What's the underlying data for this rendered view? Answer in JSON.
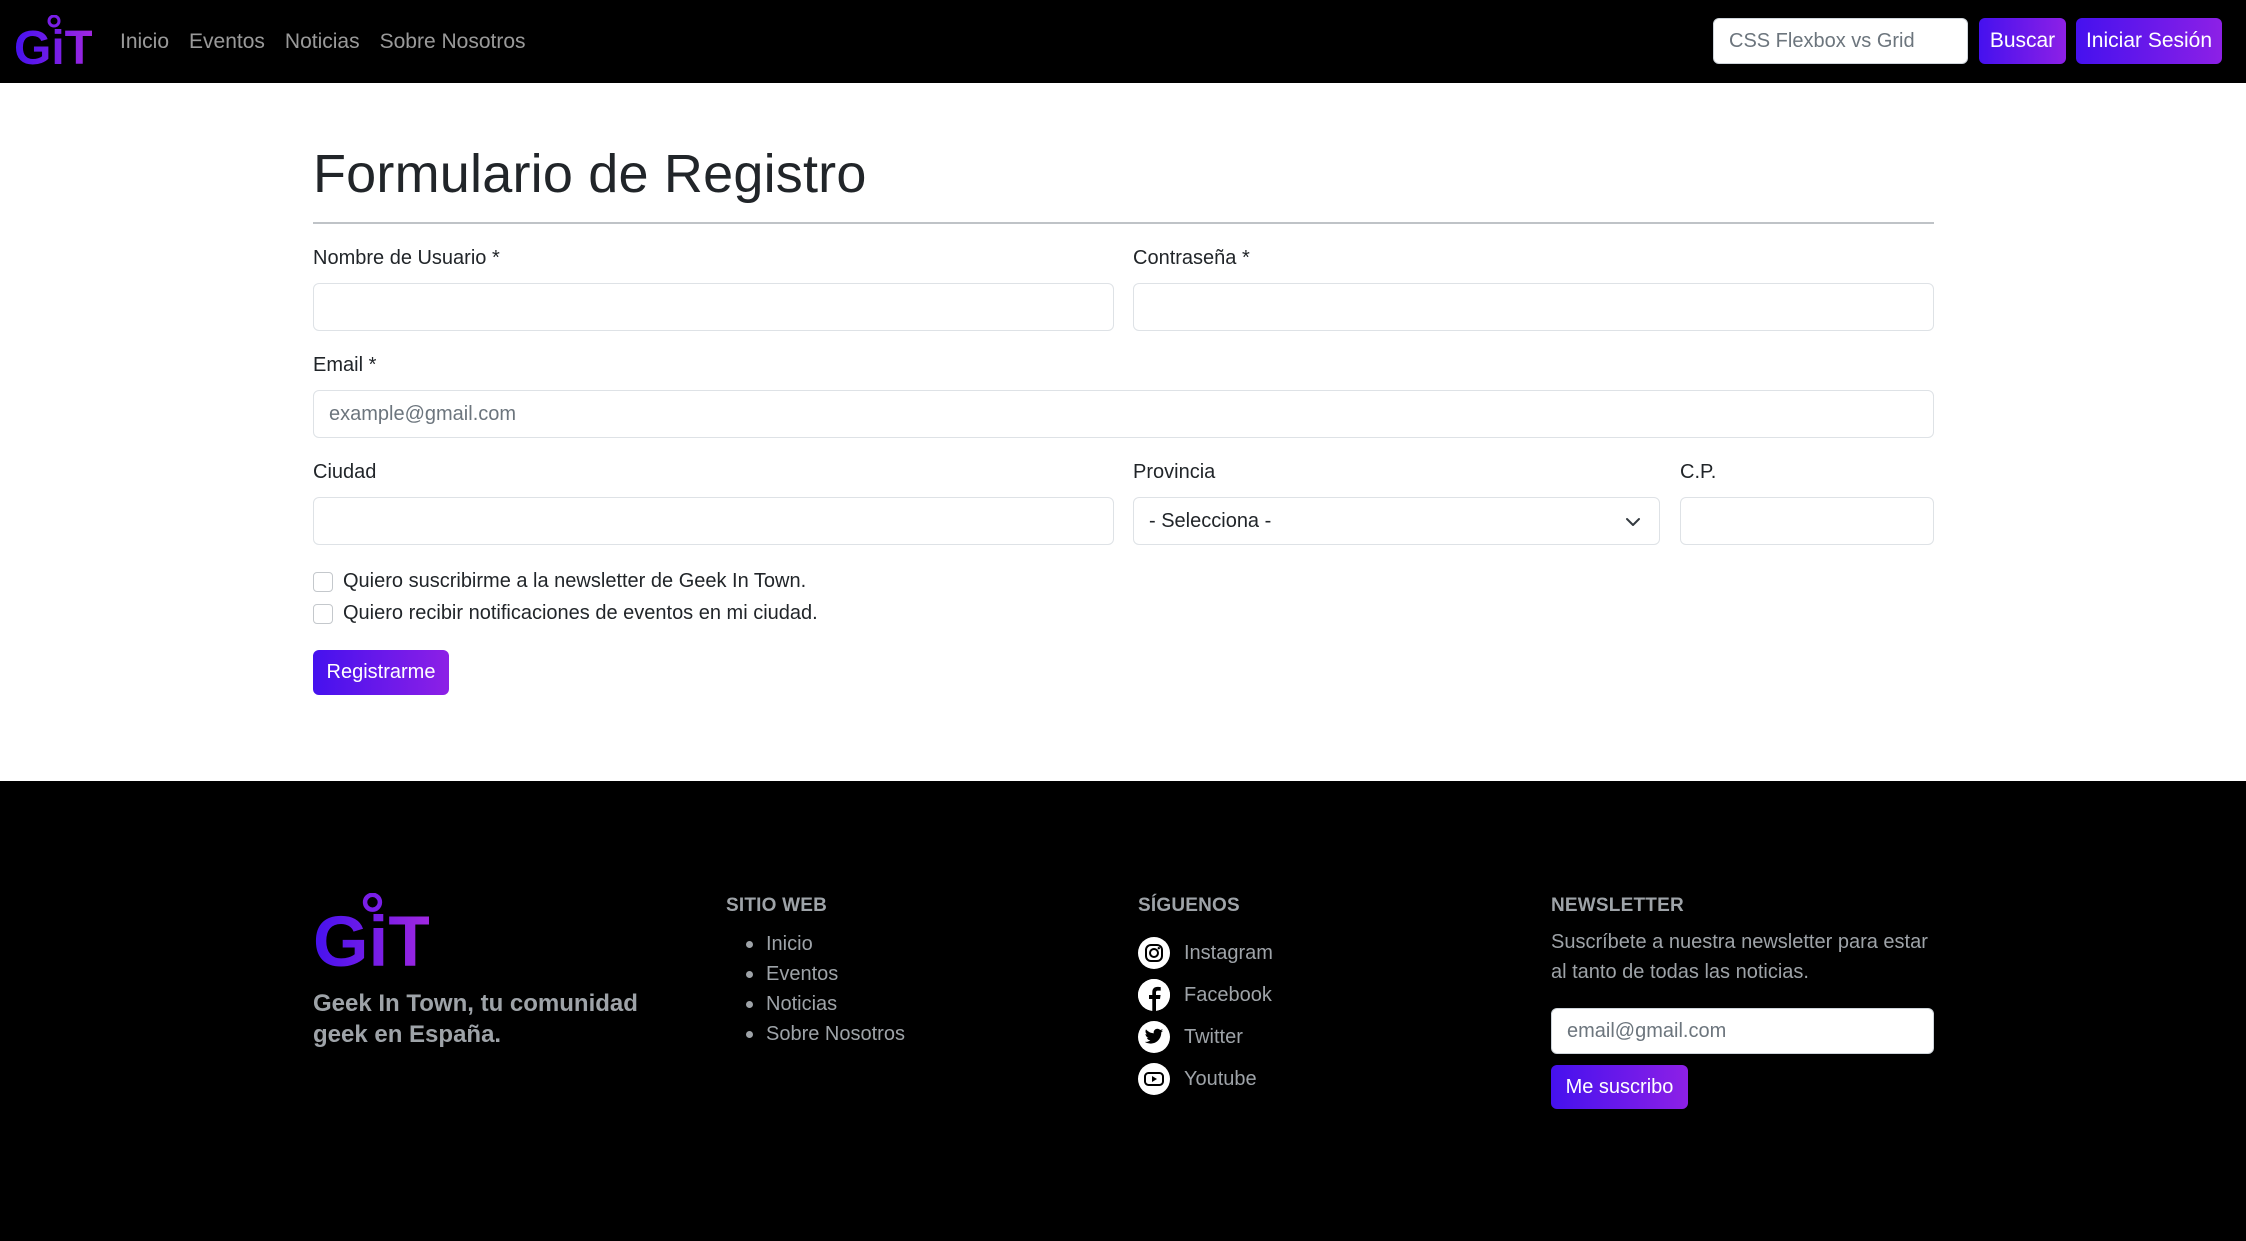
{
  "brand": {
    "logo_text": "GiT",
    "gradient": [
      "#4511ee",
      "#8d20e6"
    ]
  },
  "navbar": {
    "links": [
      "Inicio",
      "Eventos",
      "Noticias",
      "Sobre Nosotros"
    ],
    "search": {
      "value": "",
      "placeholder": "CSS Flexbox vs Grid"
    },
    "search_button": "Buscar",
    "login_button": "Iniciar Sesión"
  },
  "form": {
    "title": "Formulario de Registro",
    "username": {
      "label": "Nombre de Usuario *",
      "value": "",
      "placeholder": ""
    },
    "password": {
      "label": "Contraseña *",
      "value": "",
      "placeholder": ""
    },
    "email": {
      "label": "Email *",
      "value": "",
      "placeholder": "example@gmail.com"
    },
    "city": {
      "label": "Ciudad",
      "value": "",
      "placeholder": ""
    },
    "province": {
      "label": "Provincia",
      "selected": "- Selecciona -"
    },
    "postal_code": {
      "label": "C.P.",
      "value": "",
      "placeholder": ""
    },
    "checkboxes": [
      {
        "label": "Quiero suscribirme a la newsletter de Geek In Town.",
        "checked": false
      },
      {
        "label": "Quiero recibir notificaciones de eventos en mi ciudad.",
        "checked": false
      }
    ],
    "submit": "Registrarme"
  },
  "footer": {
    "tagline": "Geek In Town, tu comunidad geek en España.",
    "site": {
      "heading": "SITIO WEB",
      "links": [
        "Inicio",
        "Eventos",
        "Noticias",
        "Sobre Nosotros"
      ]
    },
    "follow": {
      "heading": "SÍGUENOS",
      "items": [
        {
          "label": "Instagram",
          "icon": "instagram-icon"
        },
        {
          "label": "Facebook",
          "icon": "facebook-icon"
        },
        {
          "label": "Twitter",
          "icon": "twitter-icon"
        },
        {
          "label": "Youtube",
          "icon": "youtube-icon"
        }
      ]
    },
    "newsletter": {
      "heading": "NEWSLETTER",
      "text": "Suscríbete a nuestra newsletter para estar al tanto de todas las noticias.",
      "placeholder": "email@gmail.com",
      "button": "Me suscribo"
    }
  }
}
